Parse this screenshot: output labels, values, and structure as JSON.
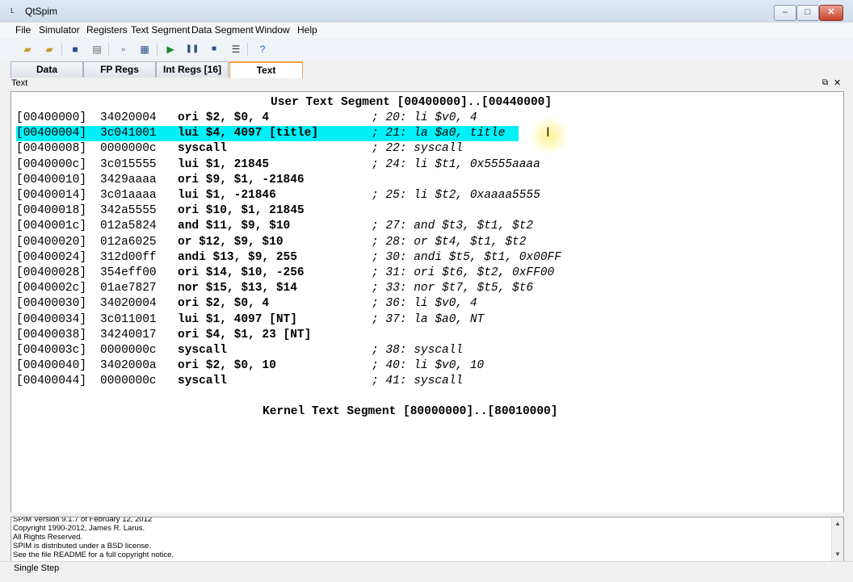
{
  "window": {
    "title": "QtSpim",
    "min": "–",
    "max": "□",
    "close": "✕"
  },
  "menu": [
    "File",
    "Simulator",
    "Registers",
    "Text Segment",
    "Data Segment",
    "Window",
    "Help"
  ],
  "tabs": [
    "Data",
    "FP Regs",
    "Int Regs [16]",
    "Text"
  ],
  "active_tab": "Text",
  "panel": {
    "title": "Text"
  },
  "code": {
    "user_header": "User Text Segment [00400000]..[00440000]",
    "kernel_header": "Kernel Text Segment [80000000]..[80010000]",
    "rows": [
      {
        "addr": "[00400000]",
        "hex": "34020004",
        "instr": "ori $2, $0, 4",
        "comment": "; 20: li $v0, 4"
      },
      {
        "addr": "[00400004]",
        "hex": "3c041001",
        "instr": "lui $4, 4097 [title]",
        "comment": "; 21: la $a0, title"
      },
      {
        "addr": "[00400008]",
        "hex": "0000000c",
        "instr": "syscall",
        "comment": "; 22: syscall"
      },
      {
        "addr": "[0040000c]",
        "hex": "3c015555",
        "instr": "lui $1, 21845",
        "comment": "; 24: li $t1, 0x5555aaaa"
      },
      {
        "addr": "[00400010]",
        "hex": "3429aaaa",
        "instr": "ori $9, $1, -21846",
        "comment": ""
      },
      {
        "addr": "[00400014]",
        "hex": "3c01aaaa",
        "instr": "lui $1, -21846",
        "comment": "; 25: li $t2, 0xaaaa5555"
      },
      {
        "addr": "[00400018]",
        "hex": "342a5555",
        "instr": "ori $10, $1, 21845",
        "comment": ""
      },
      {
        "addr": "[0040001c]",
        "hex": "012a5824",
        "instr": "and $11, $9, $10",
        "comment": "; 27: and $t3, $t1, $t2"
      },
      {
        "addr": "[00400020]",
        "hex": "012a6025",
        "instr": "or $12, $9, $10",
        "comment": "; 28: or $t4, $t1, $t2"
      },
      {
        "addr": "[00400024]",
        "hex": "312d00ff",
        "instr": "andi $13, $9, 255",
        "comment": "; 30: andi $t5, $t1, 0x00FF"
      },
      {
        "addr": "[00400028]",
        "hex": "354eff00",
        "instr": "ori $14, $10, -256",
        "comment": "; 31: ori $t6, $t2, 0xFF00"
      },
      {
        "addr": "[0040002c]",
        "hex": "01ae7827",
        "instr": "nor $15, $13, $14",
        "comment": "; 33: nor $t7, $t5, $t6"
      },
      {
        "addr": "[00400030]",
        "hex": "34020004",
        "instr": "ori $2, $0, 4",
        "comment": "; 36: li $v0, 4"
      },
      {
        "addr": "[00400034]",
        "hex": "3c011001",
        "instr": "lui $1, 4097 [NT]",
        "comment": "; 37: la $a0, NT"
      },
      {
        "addr": "[00400038]",
        "hex": "34240017",
        "instr": "ori $4, $1, 23 [NT]",
        "comment": ""
      },
      {
        "addr": "[0040003c]",
        "hex": "0000000c",
        "instr": "syscall",
        "comment": "; 38: syscall"
      },
      {
        "addr": "[00400040]",
        "hex": "3402000a",
        "instr": "ori $2, $0, 10",
        "comment": "; 40: li $v0, 10"
      },
      {
        "addr": "[00400044]",
        "hex": "0000000c",
        "instr": "syscall",
        "comment": "; 41: syscall"
      }
    ]
  },
  "highlight_color": "#00f0f8",
  "messages": [
    "SPIM Version 9.1.7 of February 12, 2012",
    "Copyright 1990-2012, James R. Larus.",
    "All Rights Reserved.",
    "SPIM is distributed under a BSD license.",
    "See the file README for a full copyright notice."
  ],
  "status": "Single Step"
}
